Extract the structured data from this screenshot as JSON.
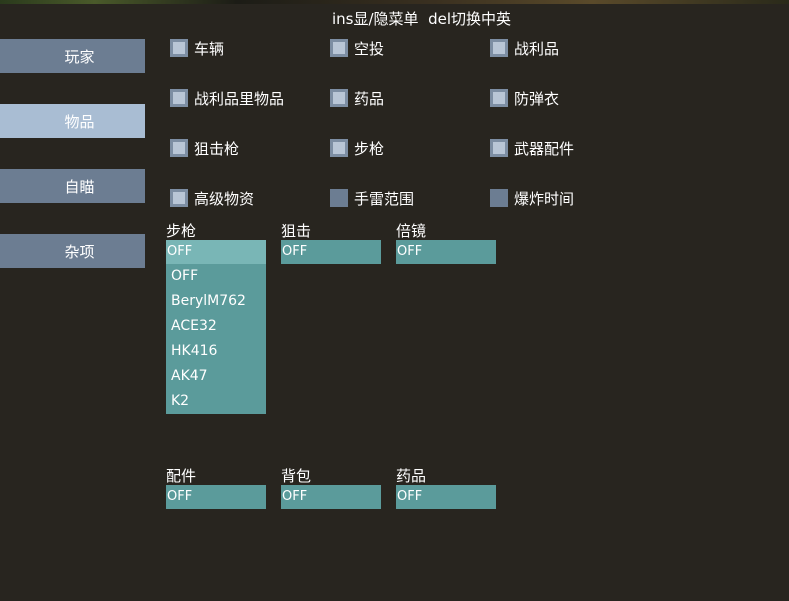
{
  "header": {
    "text": "ins显/隐菜单  del切换中英"
  },
  "tabs": [
    {
      "label": "玩家",
      "active": false
    },
    {
      "label": "物品",
      "active": true
    },
    {
      "label": "自瞄",
      "active": false
    },
    {
      "label": "杂项",
      "active": false
    }
  ],
  "checkboxes": [
    {
      "label": "车辆",
      "checked": false
    },
    {
      "label": "空投",
      "checked": false
    },
    {
      "label": "战利品",
      "checked": false
    },
    {
      "label": "战利品里物品",
      "checked": false
    },
    {
      "label": "药品",
      "checked": false
    },
    {
      "label": "防弹衣",
      "checked": false
    },
    {
      "label": "狙击枪",
      "checked": false
    },
    {
      "label": "步枪",
      "checked": false
    },
    {
      "label": "武器配件",
      "checked": false
    },
    {
      "label": "高级物资",
      "checked": false
    },
    {
      "label": "手雷范围",
      "checked": true
    },
    {
      "label": "爆炸时间",
      "checked": true
    }
  ],
  "dropdowns": {
    "rifle": {
      "label": "步枪",
      "value": "OFF",
      "options": [
        "OFF",
        "BerylM762",
        "ACE32",
        "HK416",
        "AK47",
        "K2"
      ]
    },
    "sniper": {
      "label": "狙击",
      "value": "OFF"
    },
    "scope": {
      "label": "倍镜",
      "value": "OFF"
    },
    "attachment": {
      "label": "配件",
      "value": "OFF"
    },
    "backpack": {
      "label": "背包",
      "value": "OFF"
    },
    "medicine": {
      "label": "药品",
      "value": "OFF"
    }
  },
  "colors": {
    "background": "#28251f",
    "tab": "#6c7d92",
    "tab_active": "#a9bdd3",
    "dropdown": "#5b9b9b"
  }
}
